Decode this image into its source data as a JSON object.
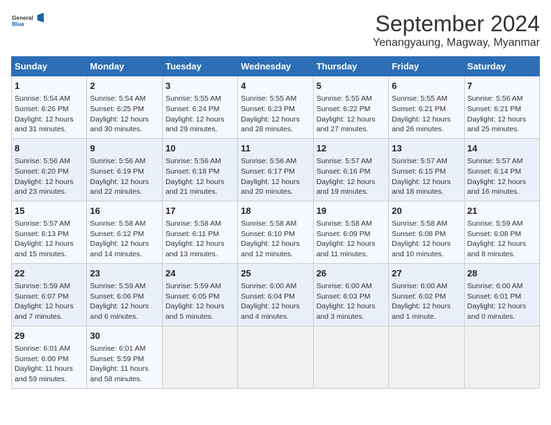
{
  "header": {
    "logo_line1": "General",
    "logo_line2": "Blue",
    "main_title": "September 2024",
    "subtitle": "Yenangyaung, Magway, Myanmar"
  },
  "calendar": {
    "columns": [
      "Sunday",
      "Monday",
      "Tuesday",
      "Wednesday",
      "Thursday",
      "Friday",
      "Saturday"
    ],
    "rows": [
      [
        {
          "day": "1",
          "info": "Sunrise: 5:54 AM\nSunset: 6:26 PM\nDaylight: 12 hours\nand 31 minutes."
        },
        {
          "day": "2",
          "info": "Sunrise: 5:54 AM\nSunset: 6:25 PM\nDaylight: 12 hours\nand 30 minutes."
        },
        {
          "day": "3",
          "info": "Sunrise: 5:55 AM\nSunset: 6:24 PM\nDaylight: 12 hours\nand 29 minutes."
        },
        {
          "day": "4",
          "info": "Sunrise: 5:55 AM\nSunset: 6:23 PM\nDaylight: 12 hours\nand 28 minutes."
        },
        {
          "day": "5",
          "info": "Sunrise: 5:55 AM\nSunset: 6:22 PM\nDaylight: 12 hours\nand 27 minutes."
        },
        {
          "day": "6",
          "info": "Sunrise: 5:55 AM\nSunset: 6:21 PM\nDaylight: 12 hours\nand 26 minutes."
        },
        {
          "day": "7",
          "info": "Sunrise: 5:56 AM\nSunset: 6:21 PM\nDaylight: 12 hours\nand 25 minutes."
        }
      ],
      [
        {
          "day": "8",
          "info": "Sunrise: 5:56 AM\nSunset: 6:20 PM\nDaylight: 12 hours\nand 23 minutes."
        },
        {
          "day": "9",
          "info": "Sunrise: 5:56 AM\nSunset: 6:19 PM\nDaylight: 12 hours\nand 22 minutes."
        },
        {
          "day": "10",
          "info": "Sunrise: 5:56 AM\nSunset: 6:18 PM\nDaylight: 12 hours\nand 21 minutes."
        },
        {
          "day": "11",
          "info": "Sunrise: 5:56 AM\nSunset: 6:17 PM\nDaylight: 12 hours\nand 20 minutes."
        },
        {
          "day": "12",
          "info": "Sunrise: 5:57 AM\nSunset: 6:16 PM\nDaylight: 12 hours\nand 19 minutes."
        },
        {
          "day": "13",
          "info": "Sunrise: 5:57 AM\nSunset: 6:15 PM\nDaylight: 12 hours\nand 18 minutes."
        },
        {
          "day": "14",
          "info": "Sunrise: 5:57 AM\nSunset: 6:14 PM\nDaylight: 12 hours\nand 16 minutes."
        }
      ],
      [
        {
          "day": "15",
          "info": "Sunrise: 5:57 AM\nSunset: 6:13 PM\nDaylight: 12 hours\nand 15 minutes."
        },
        {
          "day": "16",
          "info": "Sunrise: 5:58 AM\nSunset: 6:12 PM\nDaylight: 12 hours\nand 14 minutes."
        },
        {
          "day": "17",
          "info": "Sunrise: 5:58 AM\nSunset: 6:11 PM\nDaylight: 12 hours\nand 13 minutes."
        },
        {
          "day": "18",
          "info": "Sunrise: 5:58 AM\nSunset: 6:10 PM\nDaylight: 12 hours\nand 12 minutes."
        },
        {
          "day": "19",
          "info": "Sunrise: 5:58 AM\nSunset: 6:09 PM\nDaylight: 12 hours\nand 11 minutes."
        },
        {
          "day": "20",
          "info": "Sunrise: 5:58 AM\nSunset: 6:08 PM\nDaylight: 12 hours\nand 10 minutes."
        },
        {
          "day": "21",
          "info": "Sunrise: 5:59 AM\nSunset: 6:08 PM\nDaylight: 12 hours\nand 8 minutes."
        }
      ],
      [
        {
          "day": "22",
          "info": "Sunrise: 5:59 AM\nSunset: 6:07 PM\nDaylight: 12 hours\nand 7 minutes."
        },
        {
          "day": "23",
          "info": "Sunrise: 5:59 AM\nSunset: 6:06 PM\nDaylight: 12 hours\nand 6 minutes."
        },
        {
          "day": "24",
          "info": "Sunrise: 5:59 AM\nSunset: 6:05 PM\nDaylight: 12 hours\nand 5 minutes."
        },
        {
          "day": "25",
          "info": "Sunrise: 6:00 AM\nSunset: 6:04 PM\nDaylight: 12 hours\nand 4 minutes."
        },
        {
          "day": "26",
          "info": "Sunrise: 6:00 AM\nSunset: 6:03 PM\nDaylight: 12 hours\nand 3 minutes."
        },
        {
          "day": "27",
          "info": "Sunrise: 6:00 AM\nSunset: 6:02 PM\nDaylight: 12 hours\nand 1 minute."
        },
        {
          "day": "28",
          "info": "Sunrise: 6:00 AM\nSunset: 6:01 PM\nDaylight: 12 hours\nand 0 minutes."
        }
      ],
      [
        {
          "day": "29",
          "info": "Sunrise: 6:01 AM\nSunset: 6:00 PM\nDaylight: 11 hours\nand 59 minutes."
        },
        {
          "day": "30",
          "info": "Sunrise: 6:01 AM\nSunset: 5:59 PM\nDaylight: 11 hours\nand 58 minutes."
        },
        {
          "day": "",
          "info": ""
        },
        {
          "day": "",
          "info": ""
        },
        {
          "day": "",
          "info": ""
        },
        {
          "day": "",
          "info": ""
        },
        {
          "day": "",
          "info": ""
        }
      ]
    ]
  }
}
